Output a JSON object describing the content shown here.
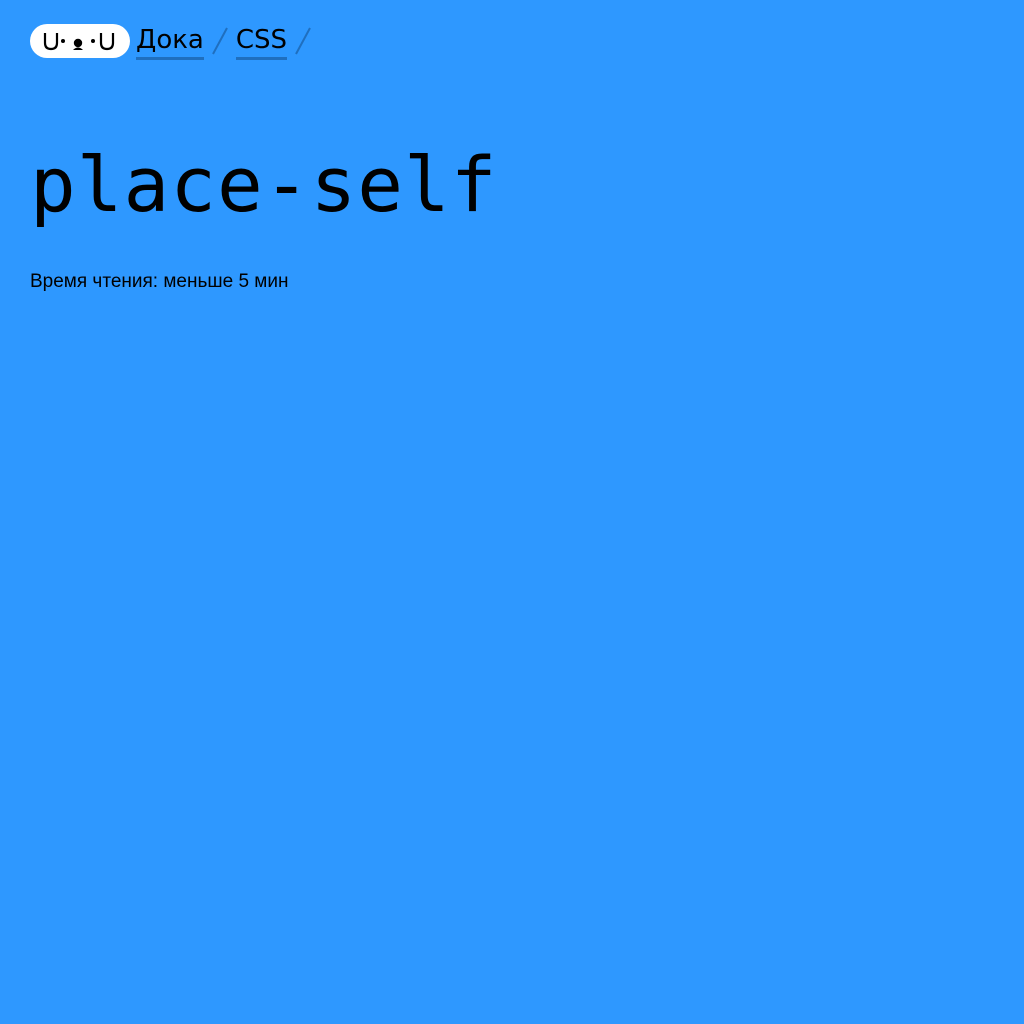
{
  "header": {
    "logo_icon": "doka-logo-icon",
    "breadcrumbs": [
      {
        "label": "Дока"
      },
      {
        "label": "CSS"
      }
    ]
  },
  "main": {
    "title": "place-self",
    "reading_time": "Время чтения: меньше 5 мин"
  },
  "colors": {
    "background": "#2e98ff",
    "logo_background": "#ffffff",
    "link_underline": "#1f6fbf",
    "text": "#000000"
  }
}
